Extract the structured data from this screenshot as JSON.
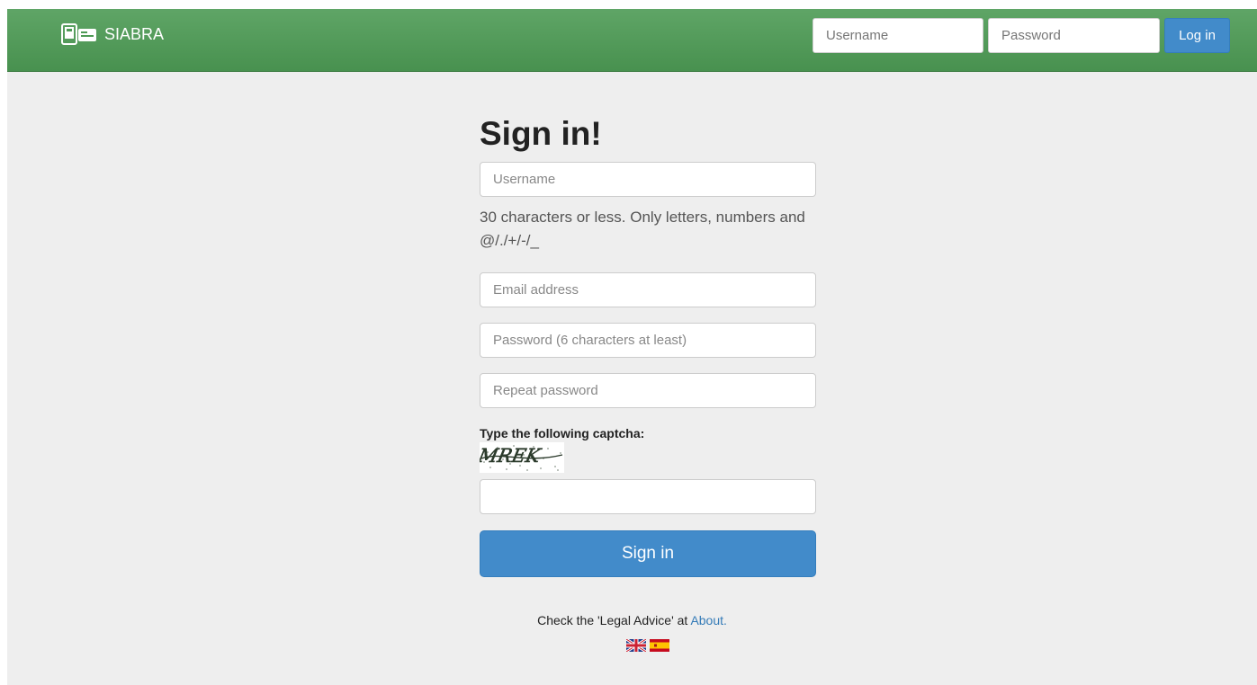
{
  "navbar": {
    "brand": "SIABRA",
    "username_placeholder": "Username",
    "password_placeholder": "Password",
    "login_label": "Log in"
  },
  "form": {
    "title": "Sign in!",
    "username_placeholder": "Username",
    "username_help": "30 characters or less. Only letters, numbers and @/./+/-/_",
    "email_placeholder": "Email address",
    "password_placeholder": "Password (6 characters at least)",
    "repeat_password_placeholder": "Repeat password",
    "captcha_label": "Type the following captcha:",
    "captcha_text": "MREK",
    "captcha_value": "",
    "submit_label": "Sign in"
  },
  "footer": {
    "note_prefix": "Check the 'Legal Advice' at ",
    "about_link": "About."
  },
  "languages": [
    "english-flag",
    "spanish-flag"
  ],
  "colors": {
    "navbar_green": "#4e9a55",
    "primary_blue": "#428bca",
    "link_blue": "#337ab7",
    "background": "#eeeeee"
  }
}
